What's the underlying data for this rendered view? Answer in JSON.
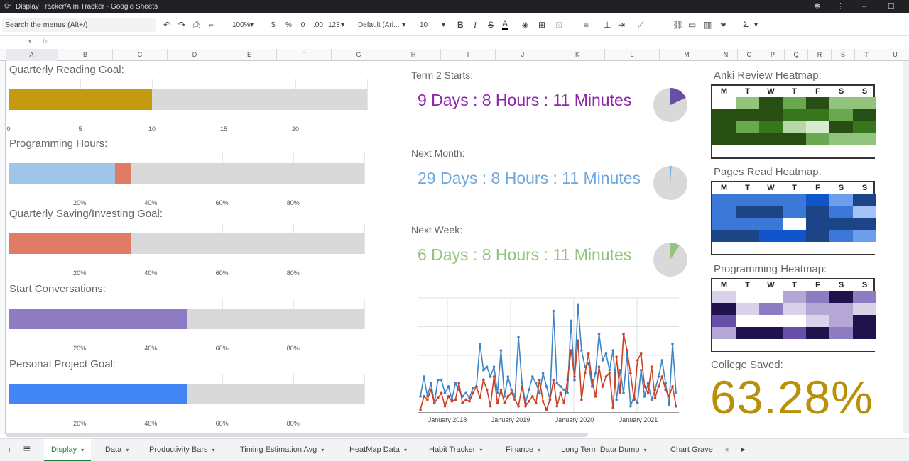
{
  "window": {
    "title": "Display Tracker/Aim Tracker - Google Sheets"
  },
  "toolbar": {
    "search_placeholder": "Search the menus (Alt+/)",
    "zoom": "100%",
    "currency": "$",
    "percent": "%",
    "dec_less": ".0",
    "dec_more": ".00",
    "format_more": "123",
    "font": "Default (Ari...",
    "font_size": "10",
    "bold": "B",
    "italic": "I",
    "strike": "S",
    "text_color": "A",
    "function_icon": "Σ"
  },
  "formula_bar": {
    "fx": "fx"
  },
  "columns": [
    "A",
    "B",
    "C",
    "D",
    "E",
    "F",
    "G",
    "H",
    "I",
    "J",
    "K",
    "L",
    "M",
    "N",
    "O",
    "P",
    "Q",
    "R",
    "S",
    "T",
    "U"
  ],
  "progress_bars": [
    {
      "title": "Quarterly Reading Goal:",
      "ticks": [
        "0",
        "5",
        "10",
        "15",
        "20"
      ],
      "tick_values": [
        0,
        5,
        10,
        15,
        20
      ],
      "axis_max": 25,
      "segments": [
        {
          "value": 10,
          "color": "#c49a0f"
        }
      ]
    },
    {
      "title": "Programming Hours:",
      "ticks": [
        "20%",
        "40%",
        "60%",
        "80%"
      ],
      "tick_values": [
        0.2,
        0.4,
        0.6,
        0.8
      ],
      "axis_max": 1,
      "segments": [
        {
          "value": 0.3,
          "color": "#9fc5e8"
        },
        {
          "value": 0.044,
          "color": "#e07b66"
        }
      ]
    },
    {
      "title": "Quarterly Saving/Investing Goal:",
      "ticks": [
        "20%",
        "40%",
        "60%",
        "80%"
      ],
      "tick_values": [
        0.2,
        0.4,
        0.6,
        0.8
      ],
      "axis_max": 1,
      "segments": [
        {
          "value": 0.344,
          "color": "#e07b66"
        }
      ]
    },
    {
      "title": "Start Conversations:",
      "ticks": [
        "20%",
        "40%",
        "60%",
        "80%"
      ],
      "tick_values": [
        0.2,
        0.4,
        0.6,
        0.8
      ],
      "axis_max": 1,
      "segments": [
        {
          "value": 0.5,
          "color": "#8e7cc3"
        }
      ]
    },
    {
      "title": "Personal Project Goal:",
      "ticks": [
        "20%",
        "40%",
        "60%",
        "80%"
      ],
      "tick_values": [
        0.2,
        0.4,
        0.6,
        0.8
      ],
      "axis_max": 1,
      "segments": [
        {
          "value": 0.5,
          "color": "#4285f4"
        }
      ]
    }
  ],
  "countdowns": [
    {
      "label": "Term 2 Starts:",
      "text": "9 Days : 8 Hours : 11 Minutes",
      "color": "#8e24aa",
      "pie_fraction": 0.18,
      "pie_color": "#674ea7"
    },
    {
      "label": "Next Month:",
      "text": "29 Days : 8 Hours : 11 Minutes",
      "color": "#6fa8dc",
      "pie_fraction": 0.01,
      "pie_color": "#6fa8dc"
    },
    {
      "label": "Next Week:",
      "text": "6 Days : 8 Hours : 11 Minutes",
      "color": "#93c47d",
      "pie_fraction": 0.09,
      "pie_color": "#93c47d"
    }
  ],
  "chart_data": {
    "type": "line",
    "x_labels": [
      "January 2018",
      "January 2019",
      "January 2020",
      "January 2021"
    ],
    "series": [
      {
        "color": "#3d85c6",
        "values": [
          1.0,
          2.2,
          1.0,
          1.8,
          0.6,
          2.0,
          2.0,
          1.2,
          1.6,
          0.8,
          1.8,
          1.4,
          1.0,
          1.2,
          0.9,
          1.5,
          1.6,
          4.2,
          2.6,
          2.8,
          2.2,
          2.8,
          1.2,
          3.8,
          1.0,
          2.2,
          1.4,
          1.0,
          4.6,
          1.8,
          0.6,
          1.4,
          2.2,
          1.8,
          1.2,
          2.4,
          1.6,
          0.8,
          6.2,
          1.8,
          1.6,
          1.4,
          1.2,
          5.6,
          2.0,
          6.6,
          3.8,
          2.8,
          3.0,
          1.6,
          2.4,
          4.8,
          3.2,
          3.6,
          2.6,
          3.8,
          0.8,
          2.6,
          1.2,
          3.6,
          0.4,
          1.0,
          0.6,
          2.6,
          1.0,
          1.8,
          0.8,
          1.4,
          2.2,
          3.2,
          1.8,
          0.5,
          4.2,
          1.2
        ]
      },
      {
        "color": "#cc4125",
        "values": [
          0.2,
          1.0,
          0.8,
          1.4,
          0.6,
          0.9,
          1.2,
          0.4,
          1.0,
          0.7,
          0.8,
          1.8,
          0.6,
          0.8,
          0.7,
          1.2,
          1.6,
          0.9,
          2.0,
          1.4,
          0.4,
          2.2,
          0.6,
          1.4,
          0.6,
          1.0,
          1.2,
          0.8,
          0.4,
          1.6,
          0.4,
          0.7,
          1.0,
          0.6,
          2.0,
          0.7,
          0.2,
          0.8,
          2.0,
          0.4,
          1.2,
          0.6,
          2.0,
          3.8,
          2.2,
          4.4,
          0.8,
          2.4,
          3.6,
          2.0,
          1.0,
          2.8,
          1.6,
          2.2,
          2.4,
          0.3,
          3.4,
          1.2,
          4.8,
          3.8,
          2.4,
          0.8,
          3.2,
          3.6,
          1.6,
          1.2,
          2.8,
          0.9,
          1.6,
          2.2,
          1.4,
          1.0,
          1.6,
          0.4
        ]
      }
    ],
    "y_range": [
      0,
      7
    ],
    "grid": true
  },
  "heatmaps": [
    {
      "title": "Anki Review Heatmap:",
      "days": [
        "M",
        "T",
        "W",
        "T",
        "F",
        "S",
        "S"
      ],
      "rows": [
        [
          "#ffffff",
          "#93c47d",
          "#274e13",
          "#6aa84f",
          "#274e13",
          "#93c47d",
          "#93c47d"
        ],
        [
          "#274e13",
          "#274e13",
          "#274e13",
          "#38761d",
          "#38761d",
          "#6aa84f",
          "#274e13"
        ],
        [
          "#274e13",
          "#6aa84f",
          "#38761d",
          "#b6d7a8",
          "#d9ead3",
          "#274e13",
          "#38761d"
        ],
        [
          "#274e13",
          "#274e13",
          "#274e13",
          "#274e13",
          "#6aa84f",
          "#93c47d",
          "#93c47d"
        ],
        [
          "#ffffff",
          "#ffffff",
          "#ffffff",
          "#ffffff",
          "#ffffff",
          "#ffffff",
          "#ffffff"
        ]
      ]
    },
    {
      "title": "Pages Read Heatmap:",
      "days": [
        "M",
        "T",
        "W",
        "T",
        "F",
        "S",
        "S"
      ],
      "rows": [
        [
          "#3c78d8",
          "#3c78d8",
          "#3c78d8",
          "#3c78d8",
          "#1155cc",
          "#6d9eeb",
          "#1c4587"
        ],
        [
          "#3c78d8",
          "#1c4587",
          "#1c4587",
          "#3c78d8",
          "#1c4587",
          "#3c78d8",
          "#a4c2f4"
        ],
        [
          "#3c78d8",
          "#3c78d8",
          "#3c78d8",
          "#ffffff",
          "#1c4587",
          "#1c4587",
          "#1c4587"
        ],
        [
          "#1c4587",
          "#1c4587",
          "#1155cc",
          "#1155cc",
          "#1c4587",
          "#3c78d8",
          "#6d9eeb"
        ],
        [
          "#ffffff",
          "#ffffff",
          "#ffffff",
          "#ffffff",
          "#ffffff",
          "#ffffff",
          "#ffffff"
        ]
      ]
    },
    {
      "title": "Programming Heatmap:",
      "days": [
        "M",
        "T",
        "W",
        "T",
        "F",
        "S",
        "S"
      ],
      "rows": [
        [
          "#d9d2e9",
          "#ffffff",
          "#ffffff",
          "#b4a7d6",
          "#8e7cc3",
          "#20124d",
          "#8e7cc3"
        ],
        [
          "#20124d",
          "#d9d2e9",
          "#8e7cc3",
          "#d9d2e9",
          "#b4a7d6",
          "#b4a7d6",
          "#d9d2e9"
        ],
        [
          "#674ea7",
          "#ffffff",
          "#ffffff",
          "#ffffff",
          "#d9d2e9",
          "#b4a7d6",
          "#20124d"
        ],
        [
          "#b4a7d6",
          "#20124d",
          "#20124d",
          "#674ea7",
          "#20124d",
          "#8e7cc3",
          "#20124d"
        ],
        [
          "#ffffff",
          "#ffffff",
          "#ffffff",
          "#ffffff",
          "#ffffff",
          "#ffffff",
          "#ffffff"
        ]
      ]
    }
  ],
  "college": {
    "label": "College Saved:",
    "value": "63.28%"
  },
  "sheet_tabs": [
    "Display",
    "Data",
    "Productivity Bars",
    "Timing Estimation Avg",
    "HeatMap Data",
    "Habit Tracker",
    "Finance",
    "Long Term Data Dump",
    "Chart Grave"
  ]
}
